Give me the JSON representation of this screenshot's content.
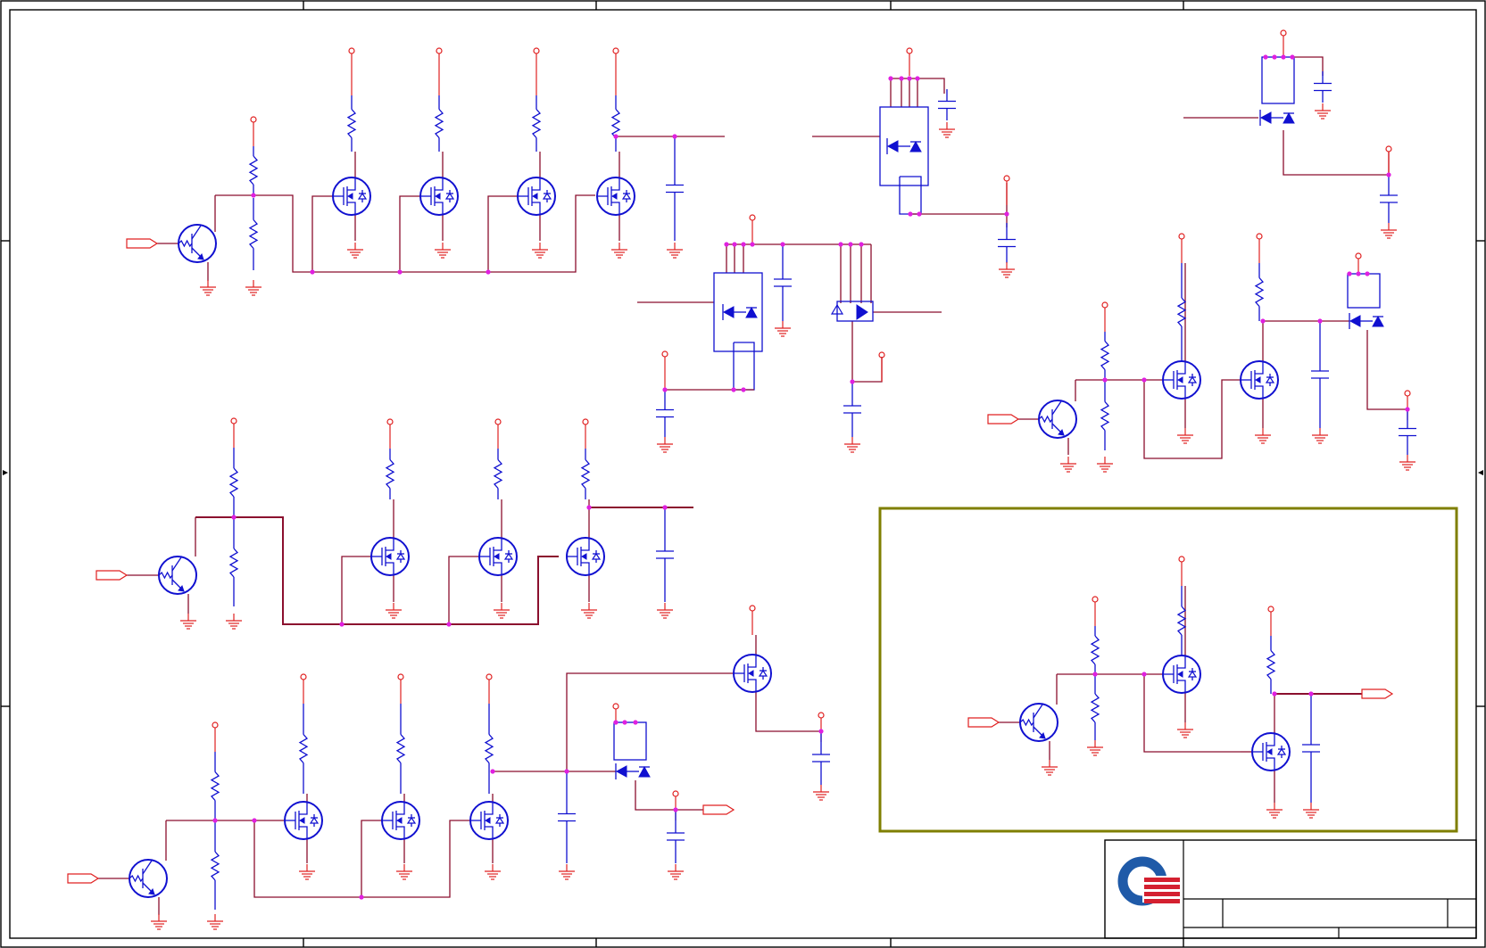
{
  "colors": {
    "wire": "#8b0f2e",
    "symbol": "#1010d0",
    "power_ground": "#e02020",
    "junction": "#e020e0",
    "highlight_box": "#7f7f00",
    "logo_blue": "#1f5aa8",
    "logo_red": "#d42030"
  },
  "sheet": {
    "border_markers": 4,
    "title_block_text": []
  },
  "icons": {
    "logo": "company-logo-icon",
    "transistor": "npn-transistor-icon",
    "mosfet": "mosfet-icon",
    "resistor": "resistor-icon",
    "capacitor": "capacitor-icon",
    "ground": "ground-icon",
    "power_rail": "power-rail-icon",
    "port": "port-connector-icon"
  }
}
